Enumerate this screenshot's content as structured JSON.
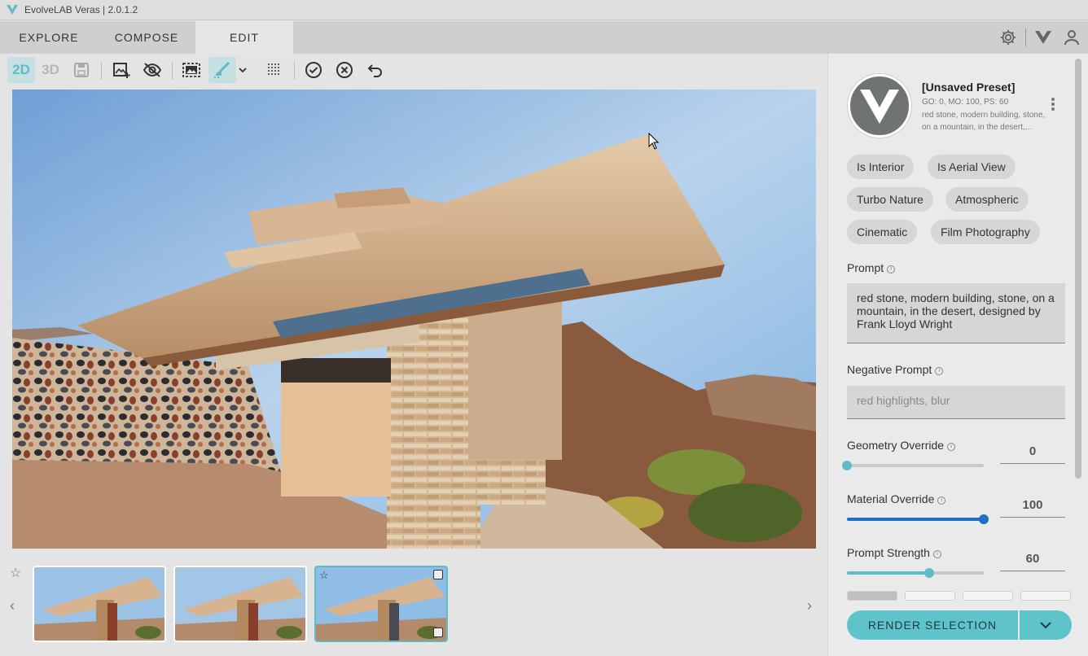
{
  "window": {
    "title": "EvolveLAB Veras | 2.0.1.2"
  },
  "nav": {
    "tabs": [
      {
        "label": "EXPLORE"
      },
      {
        "label": "COMPOSE"
      },
      {
        "label": "EDIT"
      }
    ],
    "active_tab": "EDIT"
  },
  "toolbar": {
    "mode_2d": "2D",
    "mode_3d": "3D",
    "active_mode": "2D"
  },
  "preset": {
    "title": "[Unsaved Preset]",
    "meta": "GO: 0, MO: 100, PS: 60",
    "description": "red stone, modern building, stone, on a mountain, in the desert,..."
  },
  "chips": [
    {
      "label": "Is Interior"
    },
    {
      "label": "Is Aerial View"
    },
    {
      "label": "Turbo Nature"
    },
    {
      "label": "Atmospheric"
    },
    {
      "label": "Cinematic"
    },
    {
      "label": "Film Photography"
    }
  ],
  "prompt": {
    "label": "Prompt",
    "value": "red stone, modern building, stone, on a mountain, in the desert, designed by Frank Lloyd Wright"
  },
  "negative_prompt": {
    "label": "Negative Prompt",
    "placeholder": "red highlights, blur"
  },
  "sliders": [
    {
      "label": "Geometry Override",
      "value": "0",
      "fraction": 0.0,
      "color": "#5fbcc6"
    },
    {
      "label": "Material Override",
      "value": "100",
      "fraction": 1.0,
      "color": "#1f6fc5"
    },
    {
      "label": "Prompt Strength",
      "value": "60",
      "fraction": 0.6,
      "color": "#5fbcc6"
    }
  ],
  "render": {
    "label": "RENDER SELECTION"
  },
  "colors": {
    "accent": "#5fc3cc",
    "brand": "#5fbcc6"
  }
}
